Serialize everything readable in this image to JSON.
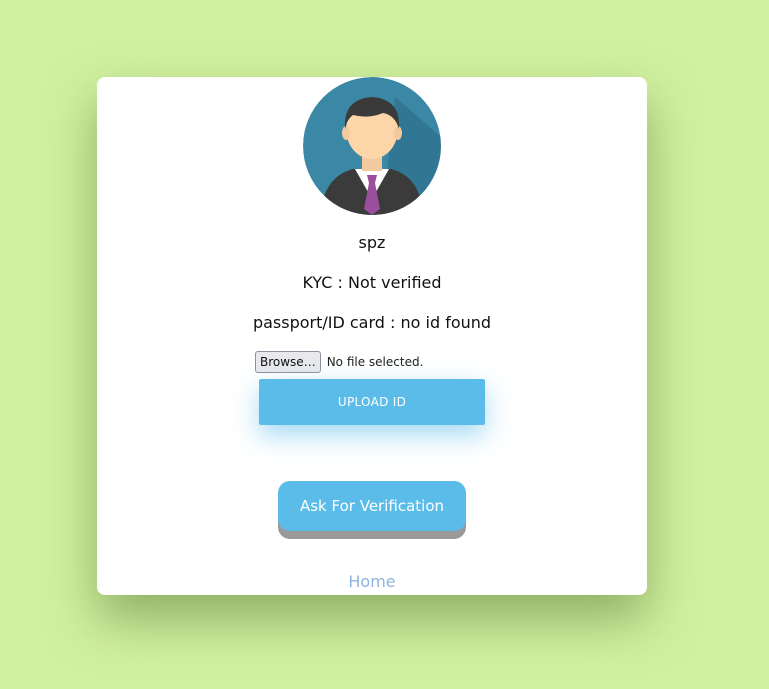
{
  "profile": {
    "avatar_icon": "user-avatar-icon",
    "username": "spz",
    "kyc_status": "KYC : Not verified",
    "id_status": "passport/ID card : no id found"
  },
  "upload": {
    "browse_label": "Browse…",
    "file_status": "No file selected.",
    "upload_label": "UPLOAD ID"
  },
  "actions": {
    "verify_label": "Ask For Verification",
    "home_label": "Home"
  },
  "colors": {
    "background": "#d0f1a0",
    "card": "#ffffff",
    "button": "#5bbcea",
    "link": "#8fb5de",
    "avatar_bg": "#3a87a6"
  }
}
